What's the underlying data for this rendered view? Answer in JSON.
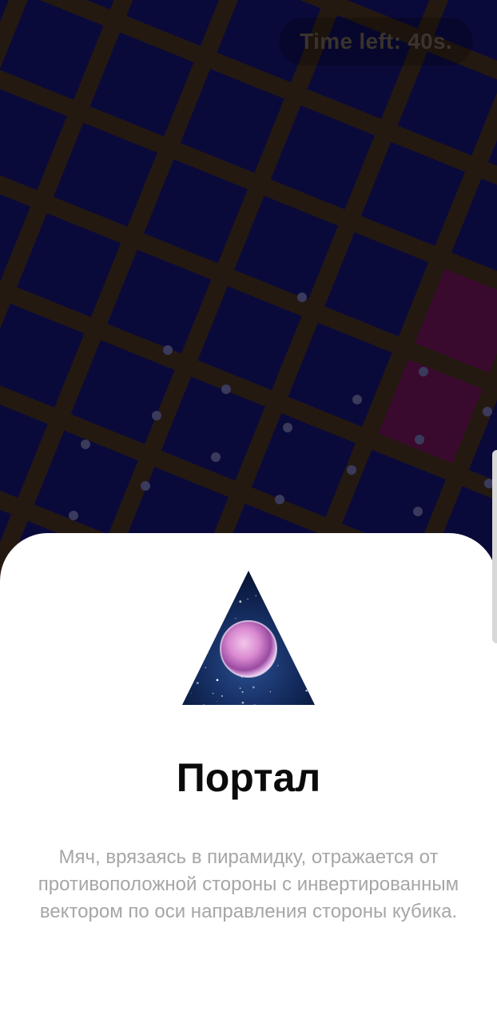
{
  "hud": {
    "timer_text": "Time left: 40s."
  },
  "card": {
    "icon": "portal-pyramid-icon",
    "title": "Портал",
    "description": "Мяч, врязаясь в пирамидку, отражается от противоположной стороны с инвертированным вектором по оси направления стороны кубика."
  },
  "colors": {
    "background": "#1a120c",
    "grid_lines": "#2c2117",
    "tile": "#0a0a3a",
    "magenta_tile": "#3a0a2e",
    "sheet": "#ffffff",
    "title": "#0b0b0b",
    "description": "#a6a6a6"
  }
}
